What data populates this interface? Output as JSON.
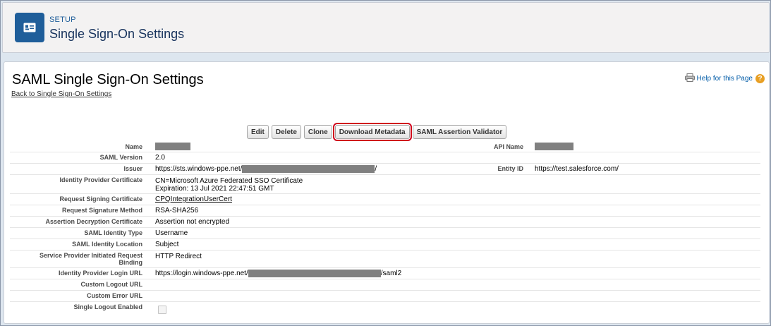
{
  "header": {
    "setup_label": "SETUP",
    "title": "Single Sign-On Settings",
    "icon": "id-card-icon",
    "icon_color": "#1f5e9a"
  },
  "page": {
    "title": "SAML Single Sign-On Settings",
    "back_link": "Back to Single Sign-On Settings",
    "help_link": "Help for this Page"
  },
  "buttons": {
    "edit": "Edit",
    "delete": "Delete",
    "clone": "Clone",
    "download_metadata": "Download Metadata",
    "saml_validator": "SAML Assertion Validator"
  },
  "fields": {
    "name": {
      "label": "Name"
    },
    "api_name": {
      "label": "API Name"
    },
    "saml_version": {
      "label": "SAML Version",
      "value": "2.0"
    },
    "issuer": {
      "label": "Issuer",
      "prefix": "https://sts.windows-ppe.net/",
      "suffix": "/"
    },
    "entity_id": {
      "label": "Entity ID",
      "value": "https://test.salesforce.com/"
    },
    "idp_cert": {
      "label": "Identity Provider Certificate",
      "line1": "CN=Microsoft Azure Federated SSO Certificate",
      "line2": "Expiration: 13 Jul 2021 22:47:51 GMT"
    },
    "req_sign_cert": {
      "label": "Request Signing Certificate",
      "value": "CPQIntegrationUserCert"
    },
    "req_sig_method": {
      "label": "Request Signature Method",
      "value": "RSA-SHA256"
    },
    "assert_decrypt": {
      "label": "Assertion Decryption Certificate",
      "value": "Assertion not encrypted"
    },
    "identity_type": {
      "label": "SAML Identity Type",
      "value": "Username"
    },
    "identity_location": {
      "label": "SAML Identity Location",
      "value": "Subject"
    },
    "sp_binding": {
      "label_line1": "Service Provider Initiated Request",
      "label_line2": "Binding",
      "value": "HTTP Redirect"
    },
    "idp_login_url": {
      "label": "Identity Provider Login URL",
      "prefix": "https://login.windows-ppe.net/",
      "suffix": "/saml2"
    },
    "custom_logout": {
      "label": "Custom Logout URL"
    },
    "custom_error": {
      "label": "Custom Error URL"
    },
    "single_logout": {
      "label": "Single Logout Enabled",
      "checked": false
    }
  }
}
